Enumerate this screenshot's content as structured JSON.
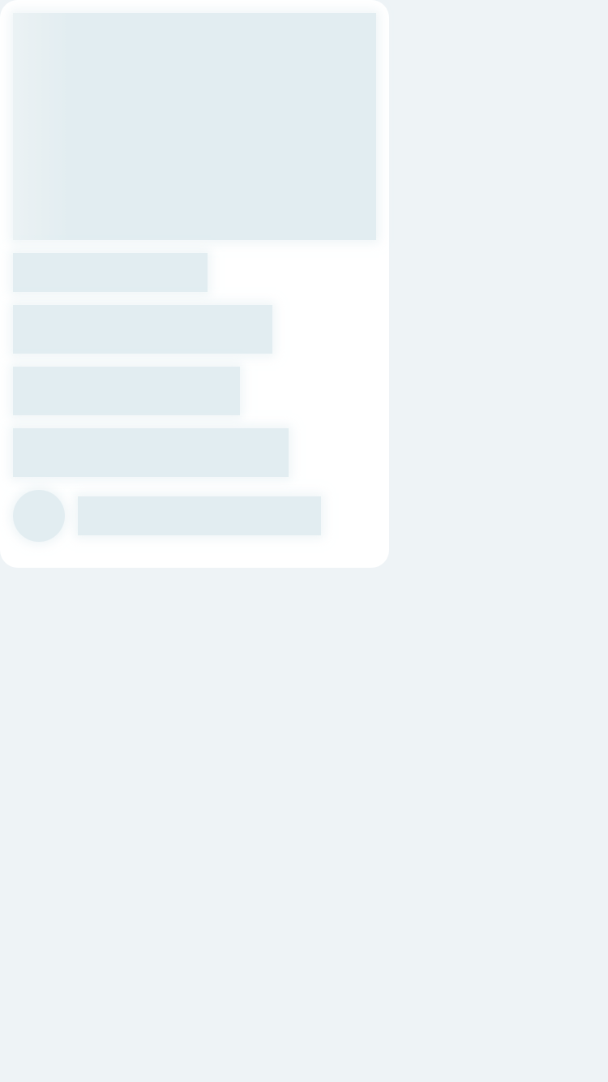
{
  "state": "loading",
  "colors": {
    "page_background": "#eef3f6",
    "card_background": "#ffffff",
    "placeholder": "#e2edf1"
  },
  "card": {
    "image_placeholder": {
      "icon": "image-placeholder"
    },
    "text_lines": [
      "",
      "",
      "",
      ""
    ],
    "author": {
      "avatar": "avatar-placeholder",
      "name": ""
    }
  }
}
